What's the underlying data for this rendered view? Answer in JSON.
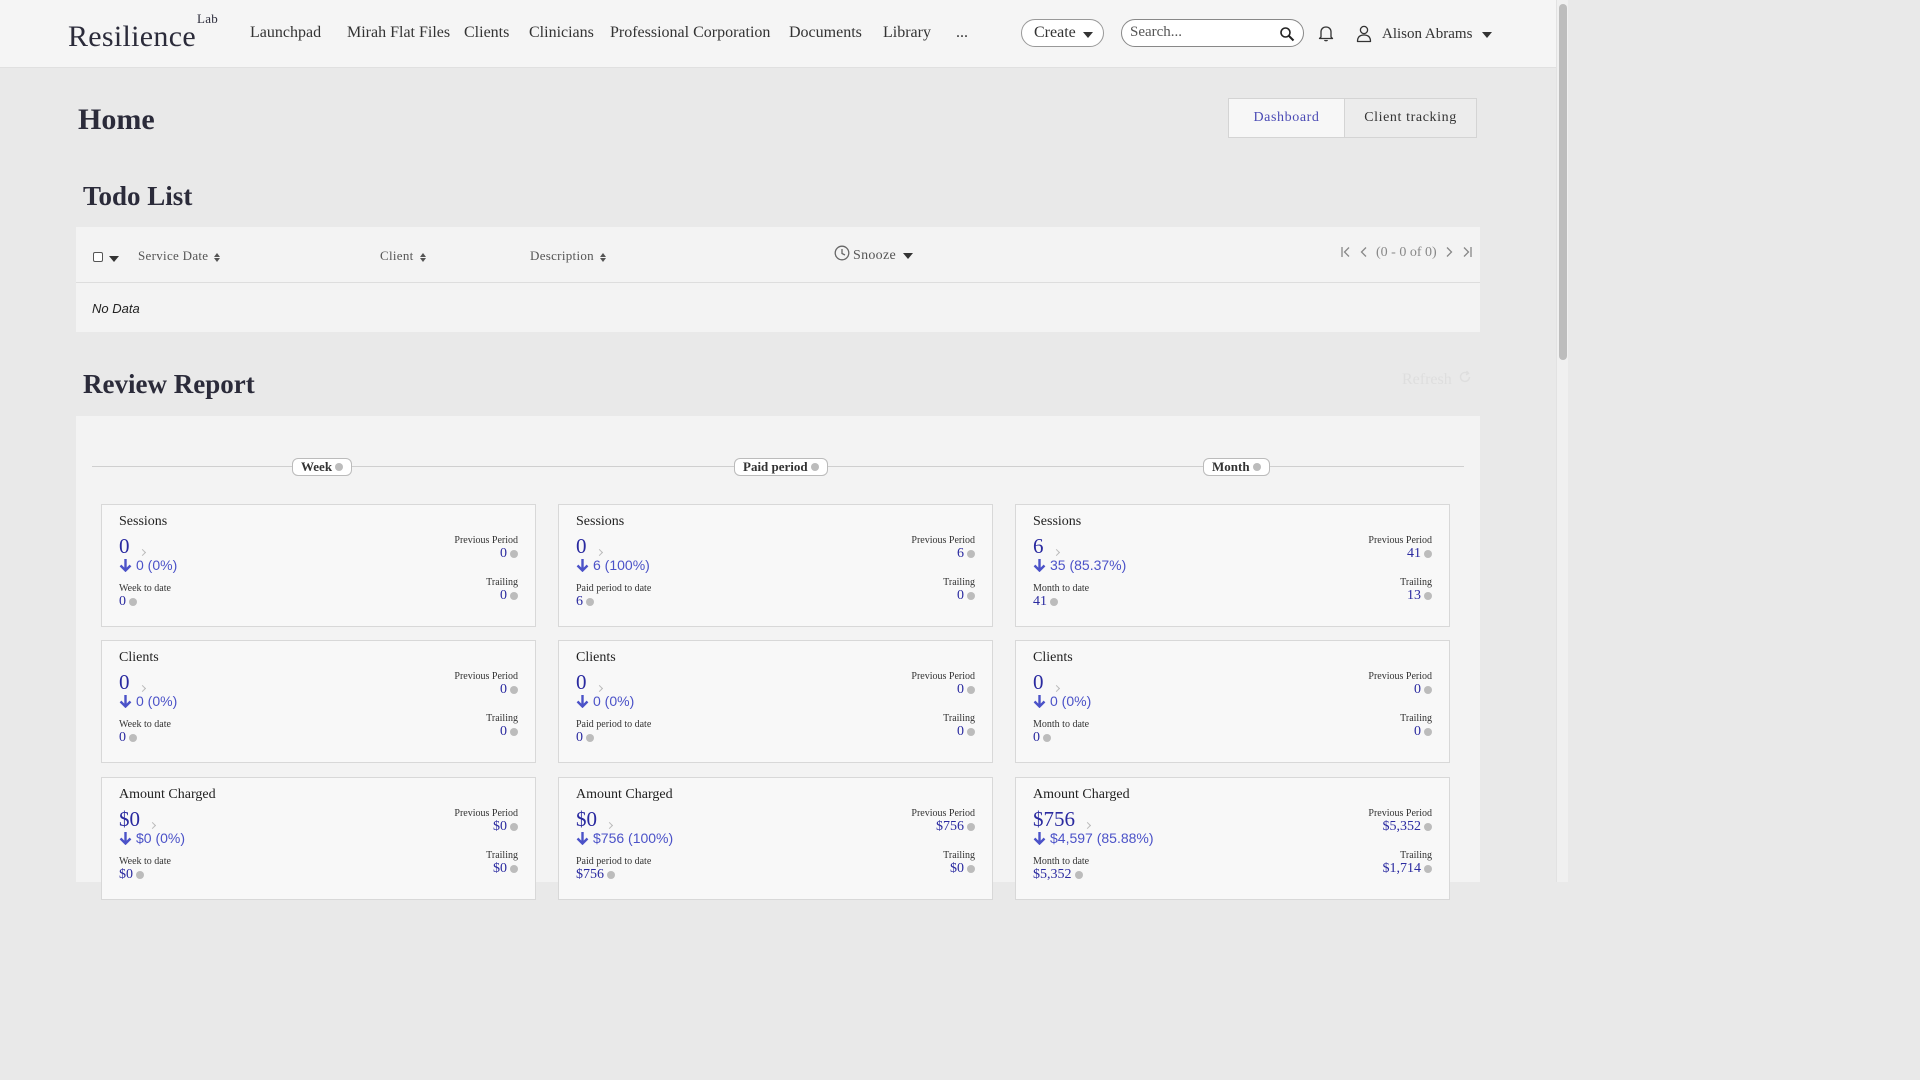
{
  "nav": {
    "logo": "Resilience",
    "logo_sup": "Lab",
    "items": [
      "Launchpad",
      "Mirah Flat Files",
      "Clients",
      "Clinicians",
      "Professional Corporation",
      "Documents",
      "Library",
      "..."
    ],
    "create_label": "Create",
    "search_placeholder": "Search...",
    "user_name": "Alison Abrams"
  },
  "page": {
    "title": "Home",
    "tabs": [
      "Dashboard",
      "Client tracking"
    ],
    "active_tab": "Dashboard"
  },
  "todo": {
    "title": "Todo List",
    "columns": [
      "Service Date",
      "Client",
      "Description"
    ],
    "snooze_label": "Snooze",
    "pager_text": "(0 - 0 of 0)",
    "empty_text": "No Data"
  },
  "review": {
    "title": "Review Report",
    "refresh_label": "Refresh",
    "periods": [
      "Week",
      "Paid period",
      "Month"
    ],
    "labels": {
      "previous": "Previous Period",
      "trailing": "Trailing"
    },
    "columns": [
      {
        "todate_label": "Week to date",
        "cards": [
          {
            "title": "Sessions",
            "value": "0",
            "delta": "0 (0%)",
            "todate": "0",
            "previous": "0",
            "trailing": "0"
          },
          {
            "title": "Clients",
            "value": "0",
            "delta": "0 (0%)",
            "todate": "0",
            "previous": "0",
            "trailing": "0"
          },
          {
            "title": "Amount Charged",
            "value": "$0",
            "delta": "$0 (0%)",
            "todate": "$0",
            "previous": "$0",
            "trailing": "$0"
          }
        ]
      },
      {
        "todate_label": "Paid period to date",
        "cards": [
          {
            "title": "Sessions",
            "value": "0",
            "delta": "6 (100%)",
            "todate": "6",
            "previous": "6",
            "trailing": "0"
          },
          {
            "title": "Clients",
            "value": "0",
            "delta": "0 (0%)",
            "todate": "0",
            "previous": "0",
            "trailing": "0"
          },
          {
            "title": "Amount Charged",
            "value": "$0",
            "delta": "$756 (100%)",
            "todate": "$756",
            "previous": "$756",
            "trailing": "$0"
          }
        ]
      },
      {
        "todate_label": "Month to date",
        "cards": [
          {
            "title": "Sessions",
            "value": "6",
            "delta": "35 (85.37%)",
            "todate": "41",
            "previous": "41",
            "trailing": "13"
          },
          {
            "title": "Clients",
            "value": "0",
            "delta": "0 (0%)",
            "todate": "0",
            "previous": "0",
            "trailing": "0"
          },
          {
            "title": "Amount Charged",
            "value": "$756",
            "delta": "$4,597 (85.88%)",
            "todate": "$5,352",
            "previous": "$5,352",
            "trailing": "$1,714"
          }
        ]
      }
    ]
  },
  "colors": {
    "accent": "#4b4bb5",
    "value_blue": "#2a2aa0",
    "background": "#e9e9e9"
  }
}
